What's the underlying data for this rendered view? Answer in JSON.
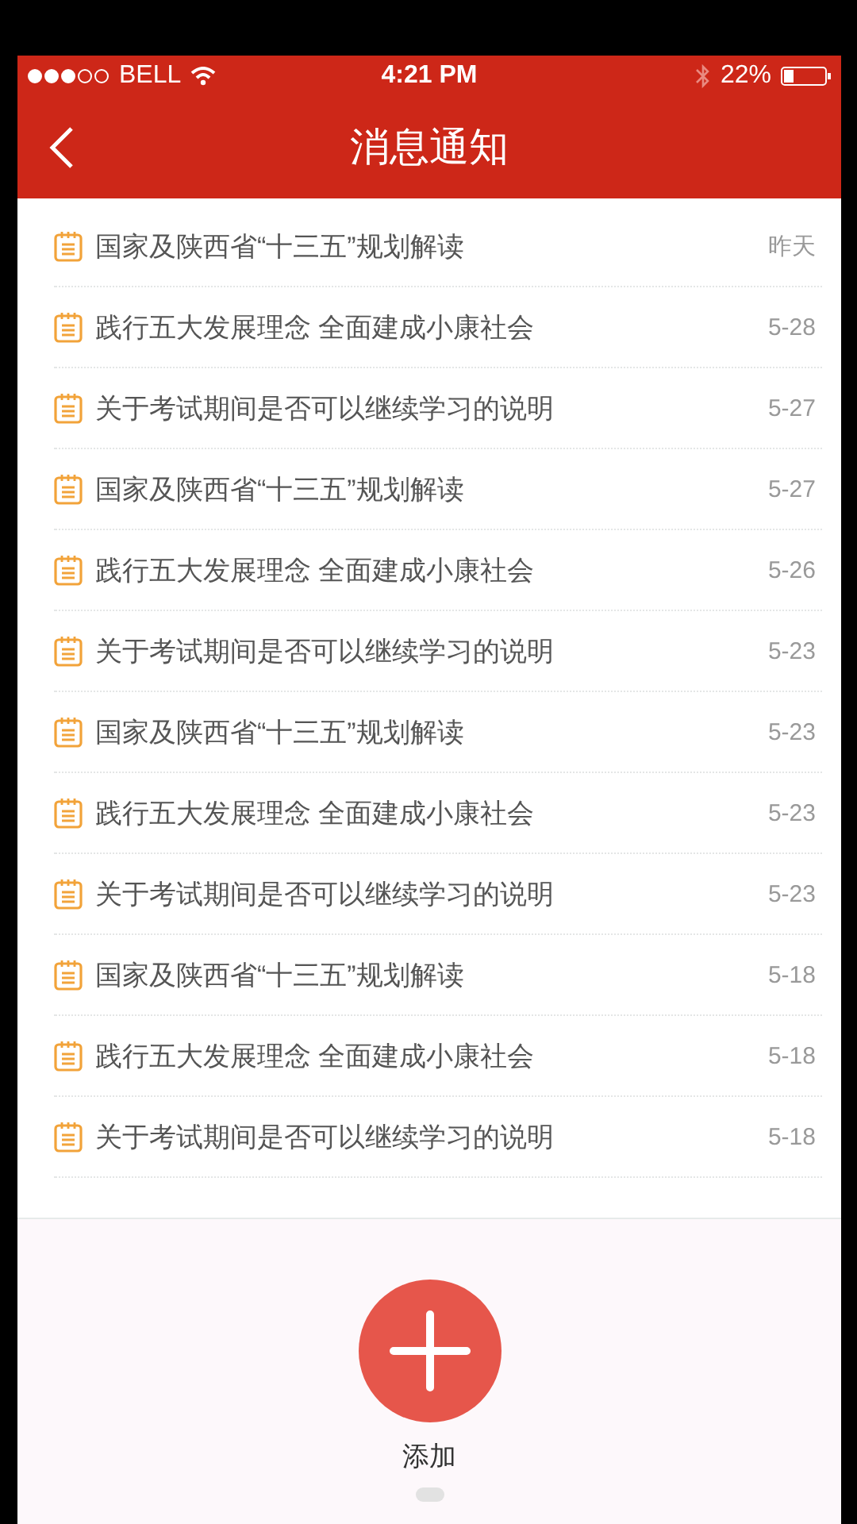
{
  "status_bar": {
    "carrier": "BELL",
    "time": "4:21 PM",
    "battery": "22%"
  },
  "nav": {
    "title": "消息通知"
  },
  "notifications": [
    {
      "title": "国家及陕西省“十三五”规划解读",
      "date": "昨天"
    },
    {
      "title": "践行五大发展理念 全面建成小康社会",
      "date": "5-28"
    },
    {
      "title": "关于考试期间是否可以继续学习的说明",
      "date": "5-27"
    },
    {
      "title": "国家及陕西省“十三五”规划解读",
      "date": "5-27"
    },
    {
      "title": "践行五大发展理念 全面建成小康社会",
      "date": "5-26"
    },
    {
      "title": "关于考试期间是否可以继续学习的说明",
      "date": "5-23"
    },
    {
      "title": "国家及陕西省“十三五”规划解读",
      "date": "5-23"
    },
    {
      "title": "践行五大发展理念 全面建成小康社会",
      "date": "5-23"
    },
    {
      "title": "关于考试期间是否可以继续学习的说明",
      "date": "5-23"
    },
    {
      "title": "国家及陕西省“十三五”规划解读",
      "date": "5-18"
    },
    {
      "title": "践行五大发展理念 全面建成小康社会",
      "date": "5-18"
    },
    {
      "title": "关于考试期间是否可以继续学习的说明",
      "date": "5-18"
    }
  ],
  "add_button": {
    "label": "添加"
  }
}
